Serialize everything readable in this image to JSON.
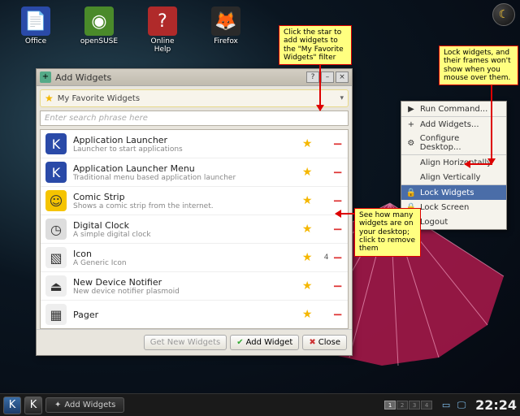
{
  "desktop_icons": [
    {
      "label": "Office",
      "color": "#2a4aa8",
      "sym": "📄"
    },
    {
      "label": "openSUSE",
      "color": "#4a8a2a",
      "sym": "◉"
    },
    {
      "label": "Online Help",
      "color": "#b02a2a",
      "sym": "?"
    },
    {
      "label": "Firefox",
      "color": "#e88a2a",
      "sym": "🦊"
    }
  ],
  "dialog": {
    "title": "Add Widgets",
    "filter": "My Favorite Widgets",
    "search_placeholder": "Enter search phrase here",
    "buttons": {
      "get_new": "Get New Widgets",
      "add": "Add Widget",
      "close": "Close"
    }
  },
  "widgets": [
    {
      "name": "Application Launcher",
      "desc": "Launcher to start applications",
      "icon": "K",
      "bg": "#2a4aa8",
      "count": ""
    },
    {
      "name": "Application Launcher Menu",
      "desc": "Traditional menu based application launcher",
      "icon": "K",
      "bg": "#2a4aa8",
      "count": ""
    },
    {
      "name": "Comic Strip",
      "desc": "Shows a comic strip from the internet.",
      "icon": "☺",
      "bg": "#f5c400",
      "count": ""
    },
    {
      "name": "Digital Clock",
      "desc": "A simple digital clock",
      "icon": "◷",
      "bg": "#ddd",
      "count": ""
    },
    {
      "name": "Icon",
      "desc": "A Generic Icon",
      "icon": "▧",
      "bg": "#eee",
      "count": "4"
    },
    {
      "name": "New Device Notifier",
      "desc": "New device notifier plasmoid",
      "icon": "⏏",
      "bg": "#eee",
      "count": ""
    },
    {
      "name": "Pager",
      "desc": "",
      "icon": "▦",
      "bg": "#eee",
      "count": ""
    }
  ],
  "context_menu": [
    {
      "label": "Run Command...",
      "icon": "▶"
    },
    {
      "label": "Add Widgets...",
      "icon": "+",
      "sep": true
    },
    {
      "label": "Configure Desktop...",
      "icon": "⚙"
    },
    {
      "label": "Align Horizontally",
      "icon": "",
      "sep": true
    },
    {
      "label": "Align Vertically",
      "icon": ""
    },
    {
      "label": "Lock Widgets",
      "icon": "🔒",
      "sel": true,
      "sep": true
    },
    {
      "label": "Lock Screen",
      "icon": "🔒"
    },
    {
      "label": "Logout",
      "icon": "⏻"
    }
  ],
  "callouts": {
    "c1": "Click the star to add widgets to the \"My Favorite Widgets\" filter",
    "c2": "Lock widgets, and their frames won't show when you mouse over them.",
    "c3": "See how many widgets are on your desktop; click to remove them"
  },
  "taskbar": {
    "task": "Add Widgets",
    "clock": "22:24",
    "pager": [
      "1",
      "2",
      "3",
      "4"
    ]
  }
}
